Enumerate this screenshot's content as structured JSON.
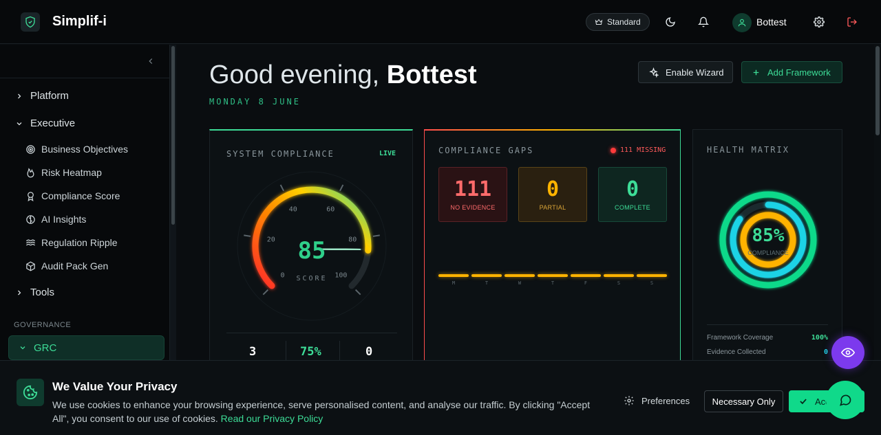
{
  "header": {
    "brand": "Simplif-i",
    "plan_badge": "Standard",
    "username": "Bottest"
  },
  "sidebar": {
    "items": [
      {
        "label": "Platform"
      },
      {
        "label": "Executive"
      },
      {
        "label": "Tools"
      }
    ],
    "sub_items": [
      {
        "label": "Business Objectives",
        "icon": "target-icon"
      },
      {
        "label": "Risk Heatmap",
        "icon": "flame-icon"
      },
      {
        "label": "Compliance Score",
        "icon": "award-icon"
      },
      {
        "label": "AI Insights",
        "icon": "brain-icon"
      },
      {
        "label": "Regulation Ripple",
        "icon": "waves-icon"
      },
      {
        "label": "Audit Pack Gen",
        "icon": "package-icon"
      }
    ],
    "section_label": "GOVERNANCE",
    "active_group": "GRC"
  },
  "main": {
    "greeting_prefix": "Good evening,",
    "greeting_name": "Bottest",
    "date": "MONDAY 8 JUNE",
    "enable_wizard": "Enable Wizard",
    "add_framework": "Add Framework"
  },
  "system_compliance": {
    "title": "SYSTEM COMPLIANCE",
    "live": "LIVE",
    "gauge": {
      "value": 85,
      "display": "85",
      "min": 0,
      "max": 100,
      "ticks": [
        "0",
        "20",
        "40",
        "60",
        "80",
        "100"
      ],
      "label": "SCORE"
    },
    "stats": [
      "3",
      "75%",
      "0"
    ]
  },
  "compliance_gaps": {
    "title": "COMPLIANCE GAPS",
    "missing": "111 MISSING",
    "boxes": [
      {
        "value": "111",
        "label": "NO EVIDENCE"
      },
      {
        "value": "0",
        "label": "PARTIAL"
      },
      {
        "value": "0",
        "label": "COMPLETE"
      }
    ],
    "days": [
      "M",
      "T",
      "W",
      "T",
      "F",
      "S",
      "S"
    ]
  },
  "health_matrix": {
    "title": "HEALTH MATRIX",
    "percent": "85%",
    "percent_value": 0.85,
    "label": "COMPLIANCE",
    "rows": [
      {
        "label": "Framework Coverage",
        "value": "100%"
      },
      {
        "label": "Evidence Collected",
        "value": "0"
      }
    ]
  },
  "cookie": {
    "title": "We Value Your Privacy",
    "text": "We use cookies to enhance your browsing experience, serve personalised content, and analyse our traffic. By clicking \"Accept All\", you consent to our use of cookies.",
    "link": "Read our Privacy Policy",
    "preferences": "Preferences",
    "necessary_only": "Necessary Only",
    "accept": "Accept All"
  },
  "colors": {
    "accent": "#3ddc97",
    "danger": "#ff4d4d",
    "warning": "#ffb300",
    "cyan": "#1fd3e6",
    "purple": "#7c3aed"
  }
}
